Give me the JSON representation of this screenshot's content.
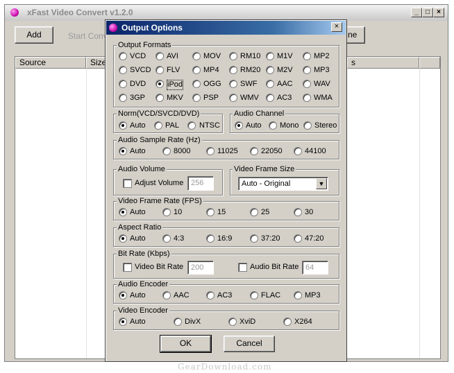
{
  "main": {
    "title": "xFast Video Convert v1.2.0",
    "add_label": "Add",
    "start_label": "Start Conv",
    "right_btn_label": "ne",
    "columns": {
      "source": "Source",
      "size": "Size",
      "other": "s"
    }
  },
  "dialog": {
    "title": "Output Options",
    "close": "×",
    "formats_label": "Output Formats",
    "formats": [
      "VCD",
      "AVI",
      "MOV",
      "RM10",
      "M1V",
      "MP2",
      "SVCD",
      "FLV",
      "MP4",
      "RM20",
      "M2V",
      "MP3",
      "DVD",
      "iPod",
      "OGG",
      "SWF",
      "AAC",
      "WAV",
      "3GP",
      "MKV",
      "PSP",
      "WMV",
      "AC3",
      "WMA"
    ],
    "formats_selected": "iPod",
    "norm": {
      "label": "Norm(VCD/SVCD/DVD)",
      "options": [
        "Auto",
        "PAL",
        "NTSC"
      ],
      "selected": "Auto"
    },
    "audio_channel": {
      "label": "Audio Channel",
      "options": [
        "Auto",
        "Mono",
        "Stereo"
      ],
      "selected": "Auto"
    },
    "sample_rate": {
      "label": "Audio Sample Rate (Hz)",
      "options": [
        "Auto",
        "8000",
        "11025",
        "22050",
        "44100"
      ],
      "selected": "Auto"
    },
    "audio_volume": {
      "label": "Audio Volume",
      "check_label": "Adjust Volume",
      "value": "256"
    },
    "frame_size": {
      "label": "Video Frame Size",
      "value": "Auto - Original"
    },
    "frame_rate": {
      "label": "Video Frame Rate (FPS)",
      "options": [
        "Auto",
        "10",
        "15",
        "25",
        "30"
      ],
      "selected": "Auto"
    },
    "aspect": {
      "label": "Aspect Ratio",
      "options": [
        "Auto",
        "4:3",
        "16:9",
        "37:20",
        "47:20"
      ],
      "selected": "Auto"
    },
    "bitrate": {
      "label": "Bit Rate (Kbps)",
      "video_label": "Video Bit Rate",
      "video_value": "200",
      "audio_label": "Audio Bit Rate",
      "audio_value": "64"
    },
    "audio_encoder": {
      "label": "Audio Encoder",
      "options": [
        "Auto",
        "AAC",
        "AC3",
        "FLAC",
        "MP3"
      ],
      "selected": "Auto"
    },
    "video_encoder": {
      "label": "Video Encoder",
      "options": [
        "Auto",
        "DivX",
        "XviD",
        "X264"
      ],
      "selected": "Auto"
    },
    "ok_label": "OK",
    "cancel_label": "Cancel"
  },
  "watermark": "GearDownload.com",
  "colors": {
    "dialog_title_start": "#0a246a",
    "dialog_title_end": "#a6caf0",
    "face": "#d4d0c8"
  }
}
